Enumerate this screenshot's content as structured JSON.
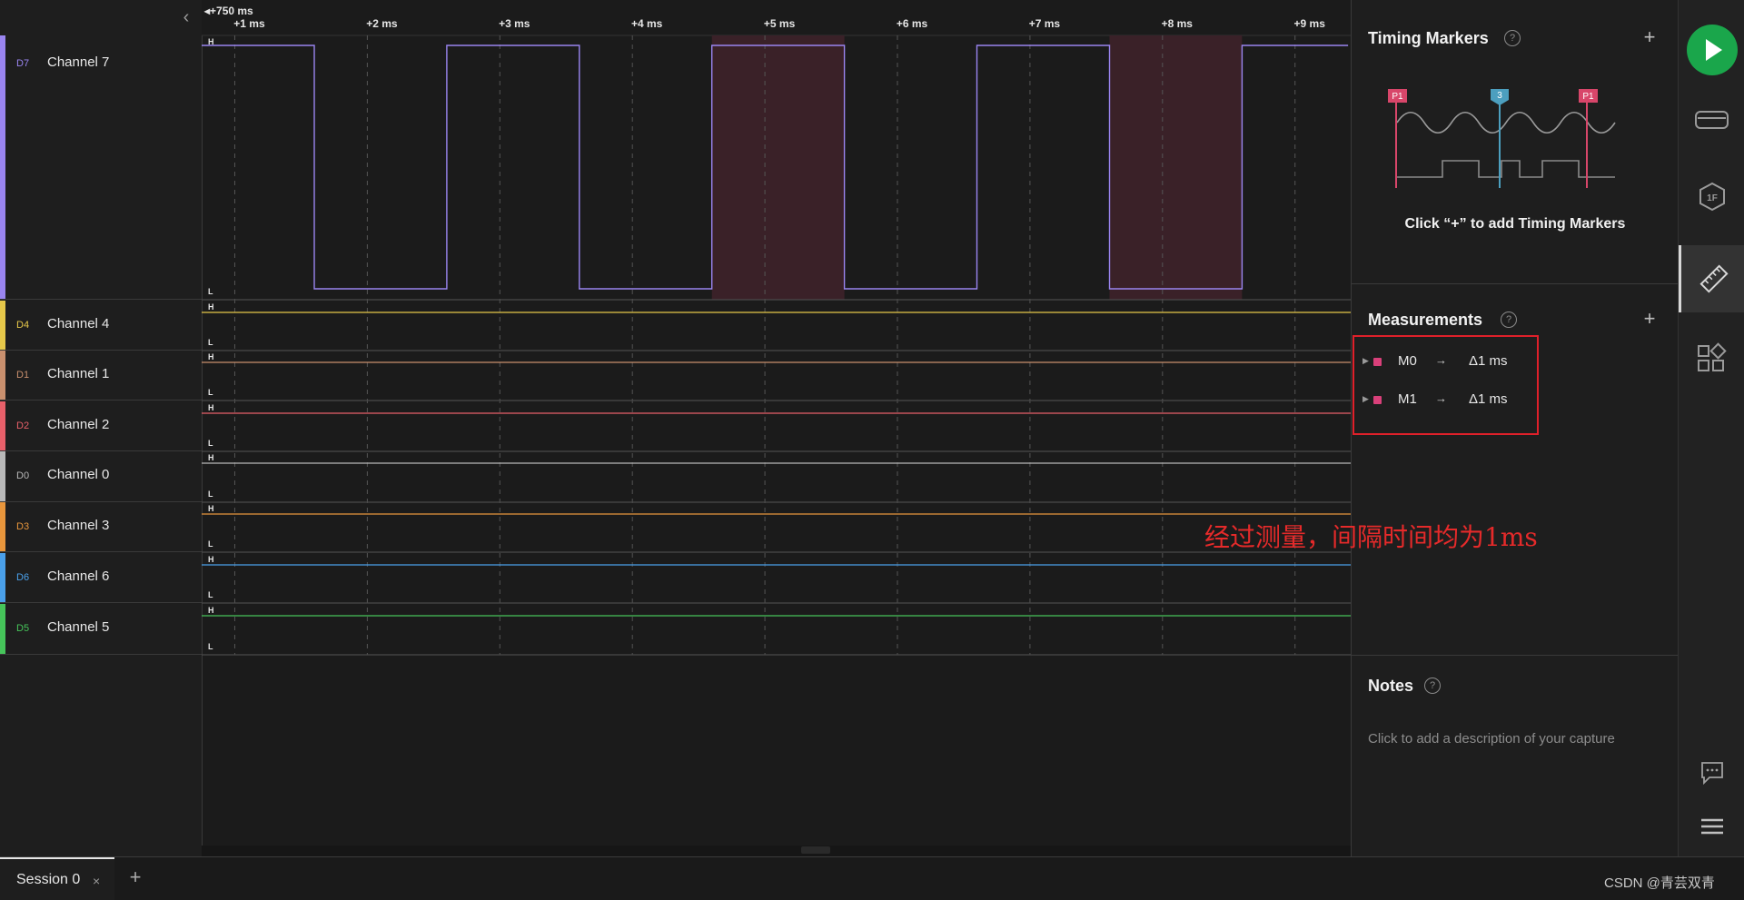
{
  "timeline": {
    "offset_label": "+750 ms",
    "ticks": [
      "+1 ms",
      "+2 ms",
      "+3 ms",
      "+4 ms",
      "+5 ms",
      "+6 ms",
      "+7 ms",
      "+8 ms",
      "+9 ms"
    ],
    "level_high": "H",
    "level_low": "L"
  },
  "channels": [
    {
      "tag": "D7",
      "name": "Channel 7",
      "color": "#9a85f0",
      "expanded": true
    },
    {
      "tag": "D4",
      "name": "Channel 4",
      "color": "#e6c84a"
    },
    {
      "tag": "D1",
      "name": "Channel 1",
      "color": "#c9906e"
    },
    {
      "tag": "D2",
      "name": "Channel 2",
      "color": "#e8606a"
    },
    {
      "tag": "D0",
      "name": "Channel 0",
      "color": "#b8b8b8"
    },
    {
      "tag": "D3",
      "name": "Channel 3",
      "color": "#e8963c"
    },
    {
      "tag": "D6",
      "name": "Channel 6",
      "color": "#4aa0ea"
    },
    {
      "tag": "D5",
      "name": "Channel 5",
      "color": "#46c45a"
    }
  ],
  "chart_data": {
    "type": "line",
    "series": [
      {
        "name": "Channel 7",
        "x": [
          0.75,
          1.6,
          1.6,
          2.6,
          2.6,
          3.6,
          3.6,
          4.6,
          4.6,
          5.6,
          5.6,
          6.6,
          6.6,
          7.6,
          7.6,
          8.6,
          8.6,
          9.4
        ],
        "y": [
          1,
          1,
          0,
          0,
          1,
          1,
          0,
          0,
          1,
          1,
          0,
          0,
          1,
          1,
          0,
          0,
          1,
          1
        ]
      }
    ],
    "measurement_spans_ms": [
      [
        4.6,
        5.6
      ],
      [
        7.6,
        8.6
      ]
    ],
    "xlim": [
      0.75,
      9.42
    ]
  },
  "side_panel": {
    "timing_markers": {
      "title": "Timing Markers",
      "hint": "Click “+” to add Timing Markers",
      "marker_labels": [
        "P1",
        "3",
        "P1"
      ]
    },
    "measurements": {
      "title": "Measurements",
      "items": [
        {
          "name": "M0",
          "arrow": "→",
          "value": "Δ1 ms"
        },
        {
          "name": "M1",
          "arrow": "→",
          "value": "Δ1 ms"
        }
      ]
    },
    "annotation": "经过测量，间隔时间均为1ms",
    "notes": {
      "title": "Notes",
      "placeholder": "Click to add a description of your capture"
    },
    "help_glyph": "?",
    "add_glyph": "+"
  },
  "bottom": {
    "session_tab": "Session 0",
    "close_glyph": "×",
    "add_glyph": "+",
    "watermark": "CSDN @青芸双青"
  },
  "colors": {
    "accent_green": "#1aa64b",
    "measurement_pink": "#d9407a",
    "annotation_red": "#e52a2a"
  }
}
